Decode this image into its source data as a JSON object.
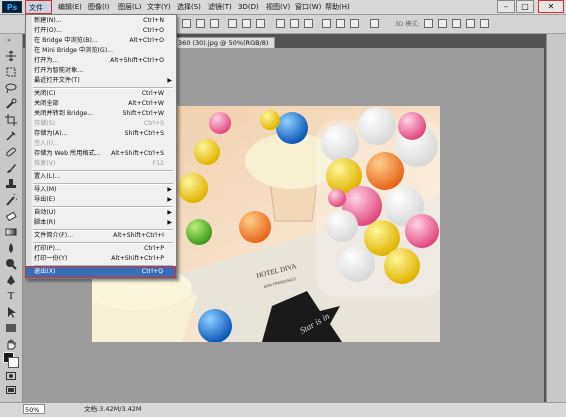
{
  "app": {
    "logo_text": "Ps"
  },
  "menubar": [
    {
      "label": "文件(F)"
    },
    {
      "label": "编辑(E)"
    },
    {
      "label": "图像(I)"
    },
    {
      "label": "图层(L)"
    },
    {
      "label": "文字(Y)"
    },
    {
      "label": "选择(S)"
    },
    {
      "label": "滤镜(T)"
    },
    {
      "label": "3D(D)"
    },
    {
      "label": "视图(V)"
    },
    {
      "label": "窗口(W)"
    },
    {
      "label": "帮助(H)"
    }
  ],
  "window_controls": {
    "minimize": "–",
    "maximize": "□",
    "close": "✕"
  },
  "options_bar": {
    "mode_3d": "3D 模式:"
  },
  "document": {
    "tab_title": "360 (30).jpg @ 50%(RGB/8)",
    "photo_text_1": "HOTEL DIVA",
    "photo_text_2": "SAN FRANCISCO",
    "photo_text_3": "Star is in"
  },
  "status": {
    "zoom": "50%",
    "doc_info": "文档:3.42M/3.42M"
  },
  "file_menu": {
    "items": [
      {
        "label": "新建(N)...",
        "shortcut": "Ctrl+N"
      },
      {
        "label": "打开(O)...",
        "shortcut": "Ctrl+O"
      },
      {
        "label": "在 Bridge 中浏览(B)...",
        "shortcut": "Alt+Ctrl+O"
      },
      {
        "label": "在 Mini Bridge 中浏览(G)...",
        "shortcut": ""
      },
      {
        "label": "打开为...",
        "shortcut": "Alt+Shift+Ctrl+O"
      },
      {
        "label": "打开为智能对象...",
        "shortcut": ""
      },
      {
        "label": "最近打开文件(T)",
        "shortcut": ""
      },
      {
        "label": "关闭(C)",
        "shortcut": "Ctrl+W"
      },
      {
        "label": "关闭全部",
        "shortcut": "Alt+Ctrl+W"
      },
      {
        "label": "关闭并转到 Bridge...",
        "shortcut": "Shift+Ctrl+W"
      },
      {
        "label": "存储(S)",
        "shortcut": "Ctrl+S"
      },
      {
        "label": "存储为(A)...",
        "shortcut": "Shift+Ctrl+S"
      },
      {
        "label": "签入(I)...",
        "shortcut": ""
      },
      {
        "label": "存储为 Web 所用格式...",
        "shortcut": "Alt+Shift+Ctrl+S"
      },
      {
        "label": "恢复(V)",
        "shortcut": "F12"
      },
      {
        "label": "置入(L)...",
        "shortcut": ""
      },
      {
        "label": "导入(M)",
        "shortcut": ""
      },
      {
        "label": "导出(E)",
        "shortcut": ""
      },
      {
        "label": "自动(U)",
        "shortcut": ""
      },
      {
        "label": "脚本(R)",
        "shortcut": ""
      },
      {
        "label": "文件简介(F)...",
        "shortcut": "Alt+Shift+Ctrl+I"
      },
      {
        "label": "打印(P)...",
        "shortcut": "Ctrl+P"
      },
      {
        "label": "打印一份(Y)",
        "shortcut": "Alt+Shift+Ctrl+P"
      },
      {
        "label": "退出(X)",
        "shortcut": "Ctrl+Q"
      }
    ],
    "submenu_arrow": "▶"
  },
  "colors": {
    "menu_highlight": "#3b6cb6",
    "annotation_red": "#d03030",
    "foreground": "#1a1a1a",
    "background": "#ffffff"
  }
}
